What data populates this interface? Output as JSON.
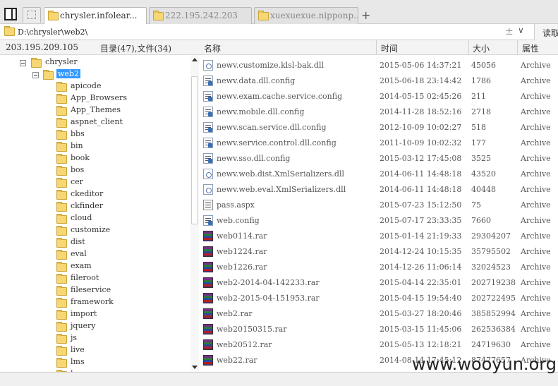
{
  "tabs": [
    {
      "label": "chrysler.infolear...",
      "active": true
    },
    {
      "label": "222.195.242.203",
      "active": false
    },
    {
      "label": "xuexuexue.nipponp...",
      "active": false
    }
  ],
  "address": {
    "path": "D:\\chrysler\\web2\\",
    "read_label": "读取"
  },
  "header": {
    "host": "203.195.209.105",
    "counts": "目录(47),文件(34)",
    "col_name": "名称",
    "col_time": "时间",
    "col_size": "大小",
    "col_attr": "属性"
  },
  "tree": {
    "root": "chrysler",
    "selected": "web2",
    "children": [
      "apicode",
      "App_Browsers",
      "App_Themes",
      "aspnet_client",
      "bbs",
      "bin",
      "book",
      "bos",
      "cer",
      "ckeditor",
      "ckfinder",
      "cloud",
      "customize",
      "dist",
      "eval",
      "exam",
      "fileroot",
      "fileservice",
      "framework",
      "import",
      "jquery",
      "js",
      "live",
      "lms",
      "l..."
    ]
  },
  "files": [
    {
      "name": "newv.customize.klsl-bak.dll",
      "time": "2015-05-06 14:37:21",
      "size": "45056",
      "attr": "Archive",
      "icon": "dll-icon"
    },
    {
      "name": "newv.data.dll.config",
      "time": "2015-06-18 23:14:42",
      "size": "1786",
      "attr": "Archive",
      "icon": "config-icon"
    },
    {
      "name": "newv.exam.cache.service.config",
      "time": "2014-05-15 02:45:26",
      "size": "211",
      "attr": "Archive",
      "icon": "config-icon"
    },
    {
      "name": "newv.mobile.dll.config",
      "time": "2014-11-28 18:52:16",
      "size": "2718",
      "attr": "Archive",
      "icon": "config-icon"
    },
    {
      "name": "newv.scan.service.dll.config",
      "time": "2012-10-09 10:02:27",
      "size": "518",
      "attr": "Archive",
      "icon": "config-icon"
    },
    {
      "name": "newv.service.control.dll.config",
      "time": "2011-10-09 10:02:32",
      "size": "177",
      "attr": "Archive",
      "icon": "config-icon"
    },
    {
      "name": "newv.sso.dll.config",
      "time": "2015-03-12 17:45:08",
      "size": "3525",
      "attr": "Archive",
      "icon": "config-icon"
    },
    {
      "name": "newv.web.dist.XmlSerializers.dll",
      "time": "2014-06-11 14:48:18",
      "size": "43520",
      "attr": "Archive",
      "icon": "dll-icon"
    },
    {
      "name": "newv.web.eval.XmlSerializers.dll",
      "time": "2014-06-11 14:48:18",
      "size": "40448",
      "attr": "Archive",
      "icon": "dll-icon"
    },
    {
      "name": "pass.aspx",
      "time": "2015-07-23 15:12:50",
      "size": "75",
      "attr": "Archive",
      "icon": "aspx-icon"
    },
    {
      "name": "web.config",
      "time": "2015-07-17 23:33:35",
      "size": "7660",
      "attr": "Archive",
      "icon": "config-icon"
    },
    {
      "name": "web0114.rar",
      "time": "2015-01-14 21:19:33",
      "size": "29304207",
      "attr": "Archive",
      "icon": "rar-icon"
    },
    {
      "name": "web1224.rar",
      "time": "2014-12-24 10:15:35",
      "size": "35795502",
      "attr": "Archive",
      "icon": "rar-icon"
    },
    {
      "name": "web1226.rar",
      "time": "2014-12-26 11:06:14",
      "size": "32024523",
      "attr": "Archive",
      "icon": "rar-icon"
    },
    {
      "name": "web2-2014-04-142233.rar",
      "time": "2015-04-14 22:35:01",
      "size": "202719238",
      "attr": "Archive",
      "icon": "rar-icon"
    },
    {
      "name": "web2-2015-04-151953.rar",
      "time": "2015-04-15 19:54:40",
      "size": "202722495",
      "attr": "Archive",
      "icon": "rar-icon"
    },
    {
      "name": "web2.rar",
      "time": "2015-03-27 18:20:46",
      "size": "385852994",
      "attr": "Archive",
      "icon": "rar-icon"
    },
    {
      "name": "web20150315.rar",
      "time": "2015-03-15 11:45:06",
      "size": "262536384",
      "attr": "Archive",
      "icon": "rar-icon"
    },
    {
      "name": "web20512.rar",
      "time": "2015-05-13 12:18:21",
      "size": "24719630",
      "attr": "Archive",
      "icon": "rar-icon"
    },
    {
      "name": "web22.rar",
      "time": "2014-08-14 17:45:12",
      "size": "87477657",
      "attr": "Archive",
      "icon": "rar-icon"
    }
  ],
  "watermark": "www.wooyun.org"
}
